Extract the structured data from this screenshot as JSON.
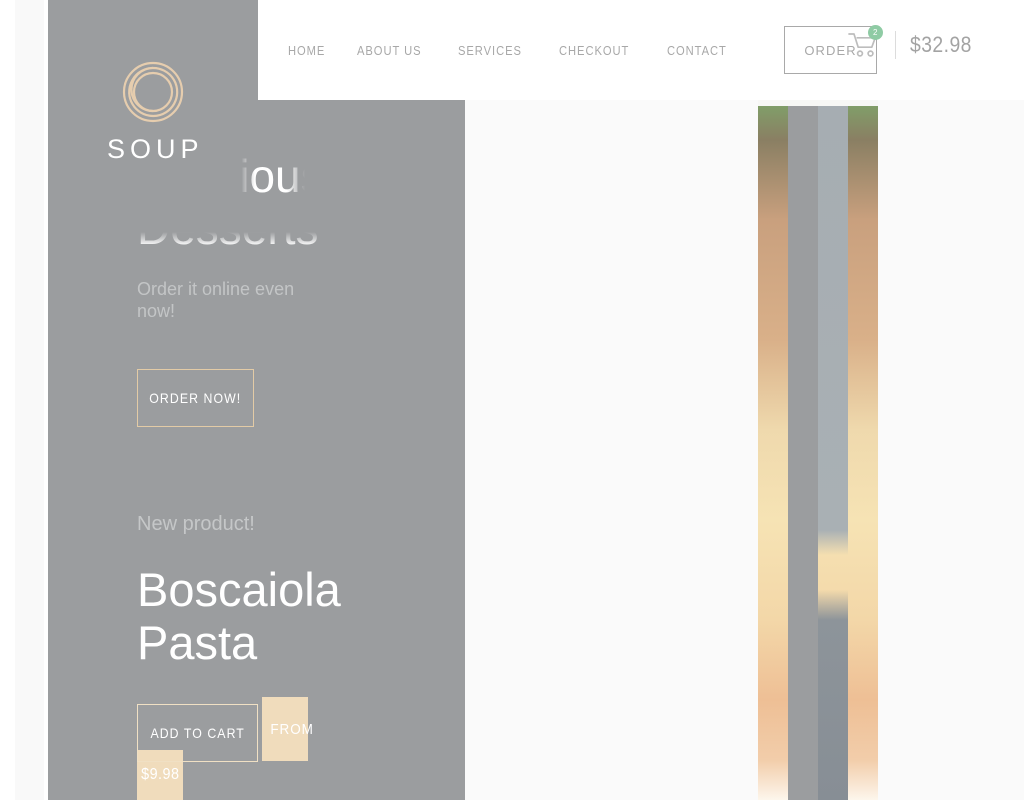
{
  "header": {
    "nav_items": [
      {
        "label": "HOME"
      },
      {
        "label": "ABOUT US"
      },
      {
        "label": "SERVICES"
      },
      {
        "label": "CHECKOUT"
      },
      {
        "label": "CONTACT"
      }
    ],
    "order_button": "ORDER",
    "cart": {
      "icon": "shopping-cart-icon",
      "badge_count": "2",
      "total": "$32.98",
      "badge_color": "#8fcba4"
    }
  },
  "logo": {
    "mark": "spiral-circle-icon",
    "wordmark": "SOUP",
    "mark_color": "#e6cdae"
  },
  "hero": {
    "heading_line1": "Delicious",
    "heading_line2": "Desserts",
    "subtitle": "Order it online even now!",
    "cta": "ORDER NOW!",
    "cta_border_color": "#e3cba6",
    "panel_color": "#9b9d9f"
  },
  "product": {
    "kicker": "New product!",
    "title_line1": "Boscaiola",
    "title_line2": "Pasta",
    "add_to_cart": "ADD TO CART",
    "from_label": "FROM",
    "price": "$9.98",
    "chip_color": "#f0dcbc"
  },
  "media": {
    "photo_alt": "pasta-dish-photo",
    "transition": "vertical-slice-reveal"
  }
}
